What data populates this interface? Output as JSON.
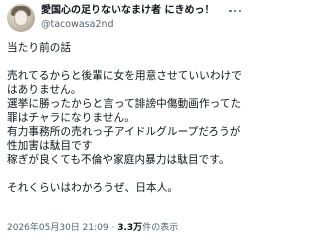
{
  "author": {
    "display_name": "愛国心の足りないなまけ者 にきめっ！",
    "handle": "@tacowasa2nd"
  },
  "body": {
    "line1": "当たり前の話",
    "line2": "売れてるからと後輩に女を用意させていいわけではありません。",
    "line3": "選挙に勝ったからと言って誹謗中傷動画作ってた罪はチャラになりません。",
    "line4": "有力事務所の売れっ子アイドルグループだろうが性加害は駄目です",
    "line5": "稼ぎが良くても不倫や家庭内暴力は駄目です。",
    "line6": "それくらいはわかろうぜ、日本人。"
  },
  "meta": {
    "timestamp": "2026年05月30日 21:09",
    "separator": "·",
    "views_count": "3.3万",
    "views_label": "件の表示"
  },
  "icons": {
    "more": "more-horizontal-icon",
    "avatar": "user-avatar"
  }
}
